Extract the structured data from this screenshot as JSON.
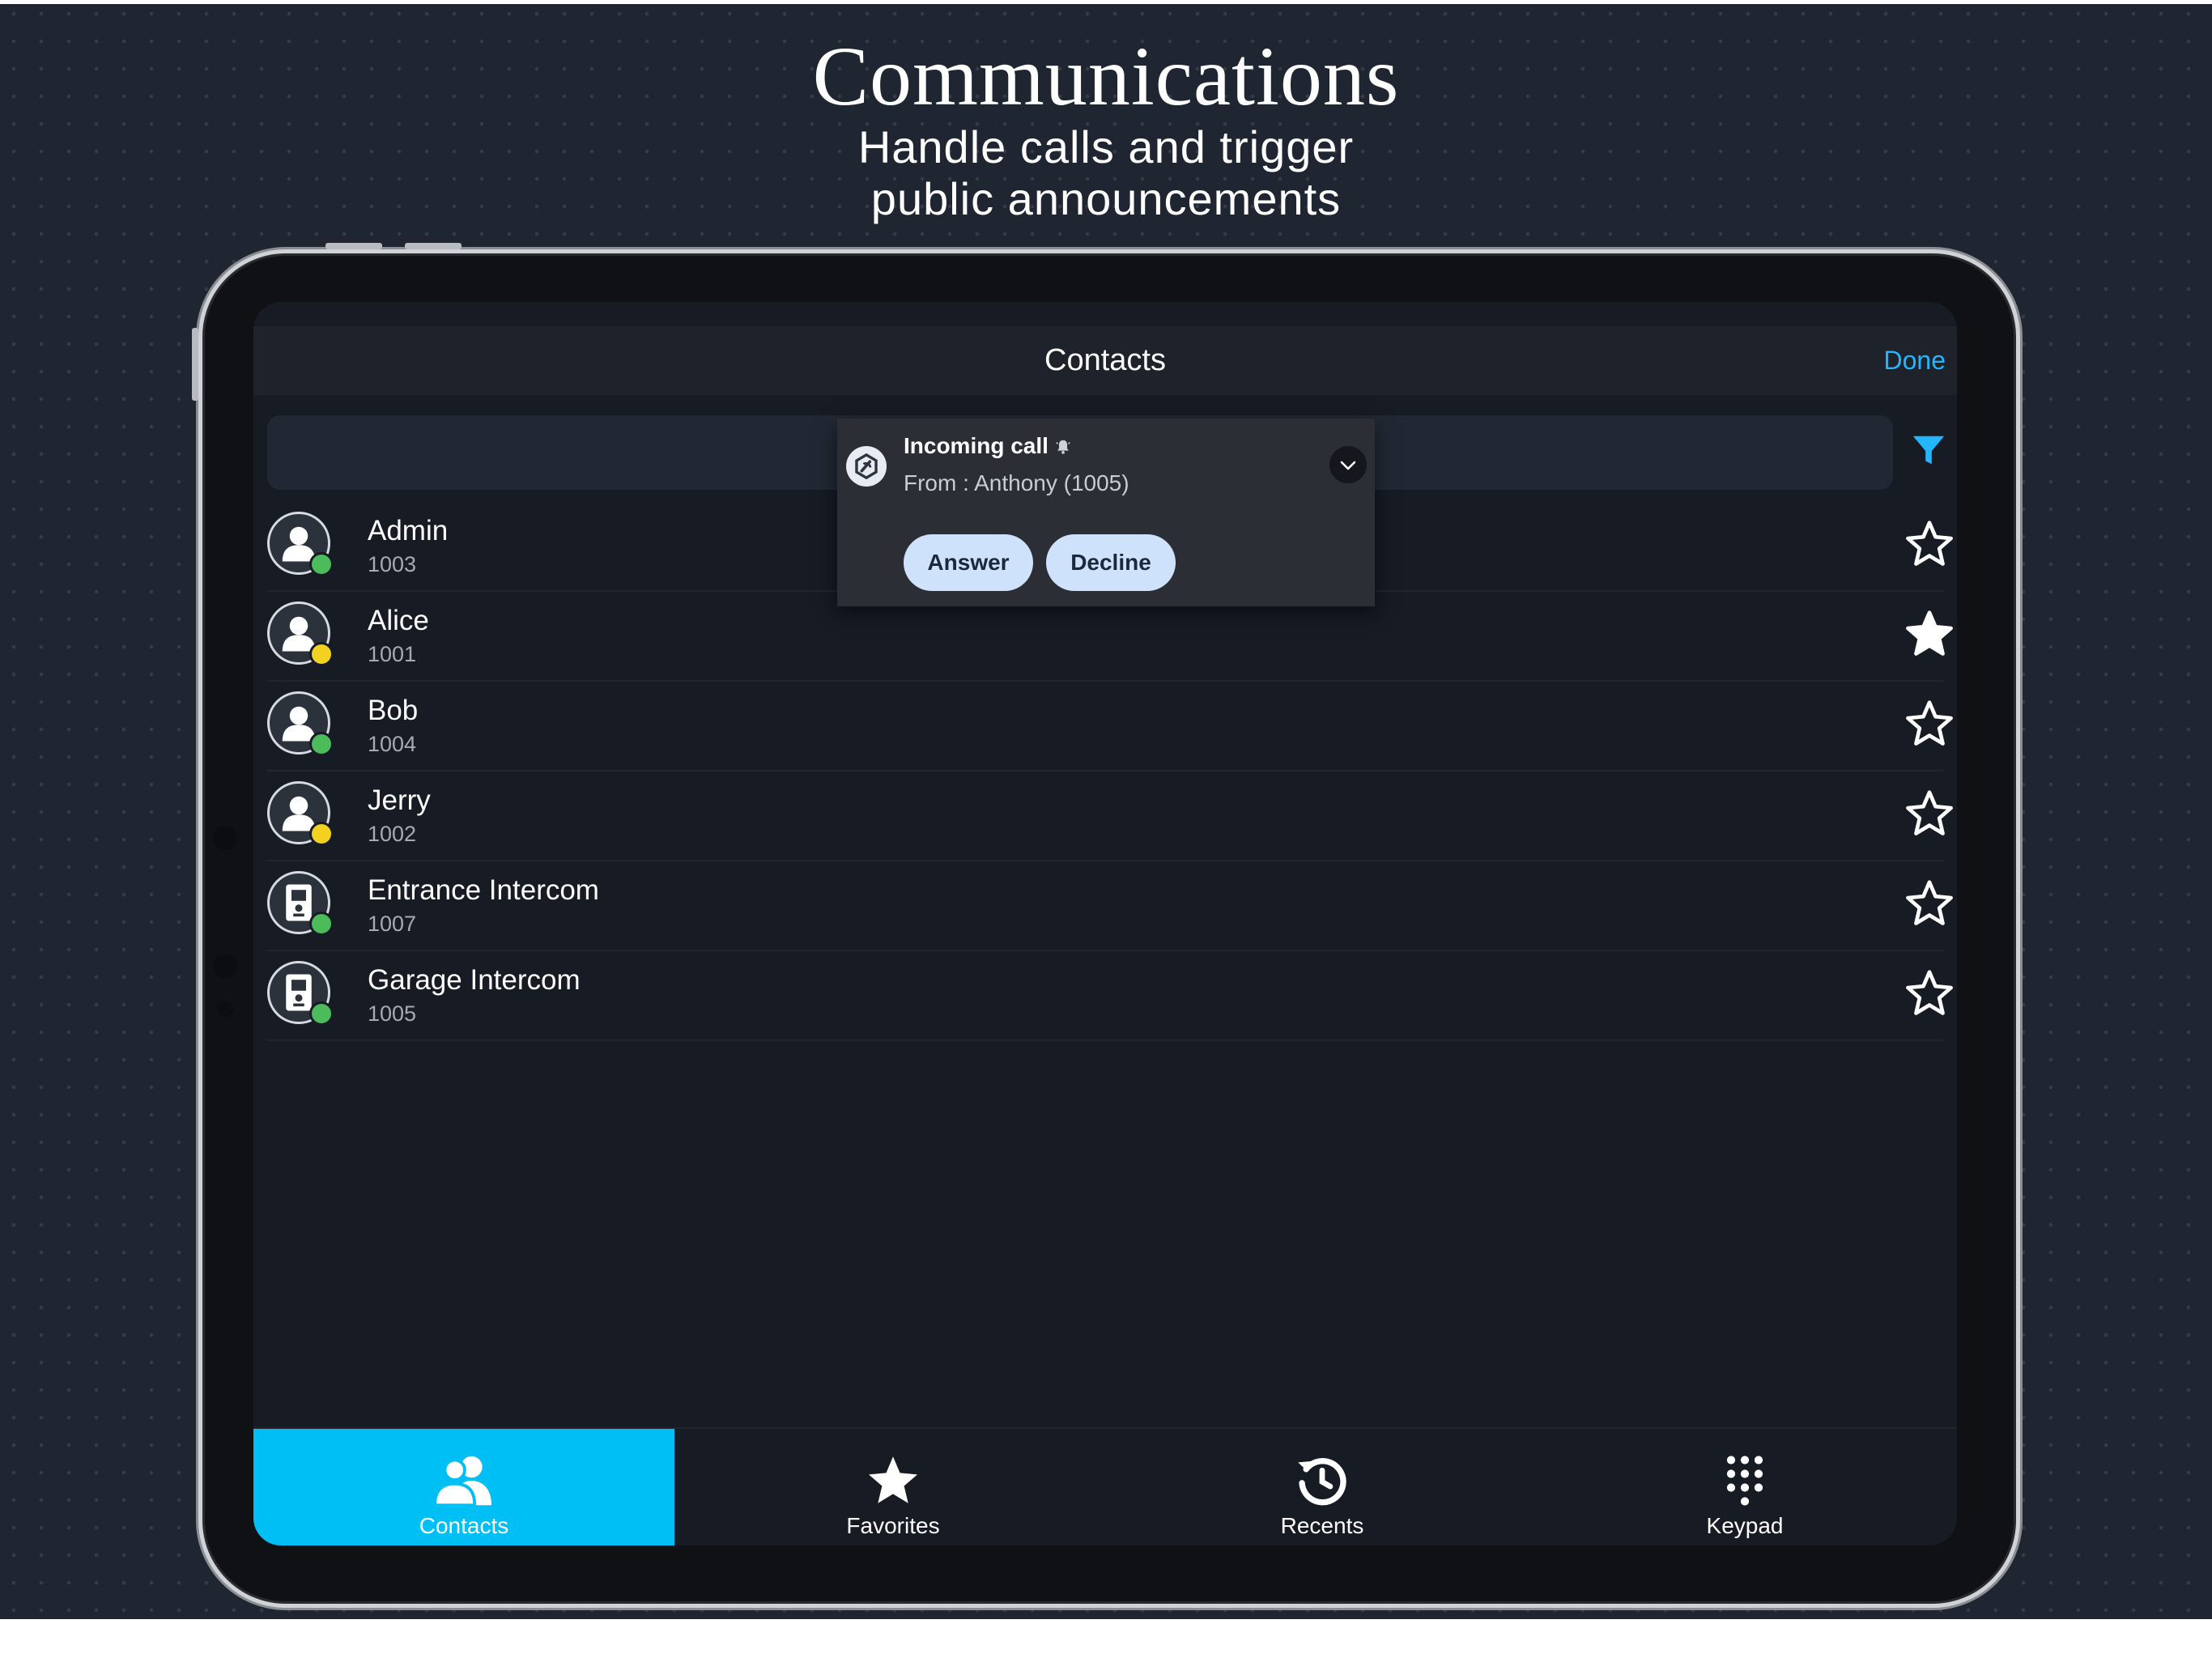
{
  "promo": {
    "title": "Communications",
    "subtitle_line1": "Handle calls and trigger",
    "subtitle_line2": "public announcements"
  },
  "navbar": {
    "title": "Contacts",
    "done_label": "Done"
  },
  "search": {
    "placeholder": ""
  },
  "colors": {
    "accent": "#00bff5",
    "link": "#23b6ff",
    "status_available": "#4cbb5a",
    "status_away": "#f2d120",
    "background": "#161b24"
  },
  "contacts": [
    {
      "name": "Admin",
      "ext": "1003",
      "status": "available",
      "type": "person",
      "favorite": false
    },
    {
      "name": "Alice",
      "ext": "1001",
      "status": "away",
      "type": "person",
      "favorite": true
    },
    {
      "name": "Bob",
      "ext": "1004",
      "status": "available",
      "type": "person",
      "favorite": false
    },
    {
      "name": "Jerry",
      "ext": "1002",
      "status": "away",
      "type": "person",
      "favorite": false
    },
    {
      "name": "Entrance Intercom",
      "ext": "1007",
      "status": "available",
      "type": "intercom",
      "favorite": false
    },
    {
      "name": "Garage Intercom",
      "ext": "1005",
      "status": "available",
      "type": "intercom",
      "favorite": false
    }
  ],
  "incoming_call": {
    "title": "Incoming call",
    "from": "From : Anthony (1005)",
    "answer_label": "Answer",
    "decline_label": "Decline",
    "app_icon": "app-logo-icon",
    "bell_icon": "bell-icon"
  },
  "tabs": [
    {
      "label": "Contacts",
      "icon": "contacts-icon",
      "active": true
    },
    {
      "label": "Favorites",
      "icon": "star-icon",
      "active": false
    },
    {
      "label": "Recents",
      "icon": "history-icon",
      "active": false
    },
    {
      "label": "Keypad",
      "icon": "keypad-icon",
      "active": false
    }
  ]
}
